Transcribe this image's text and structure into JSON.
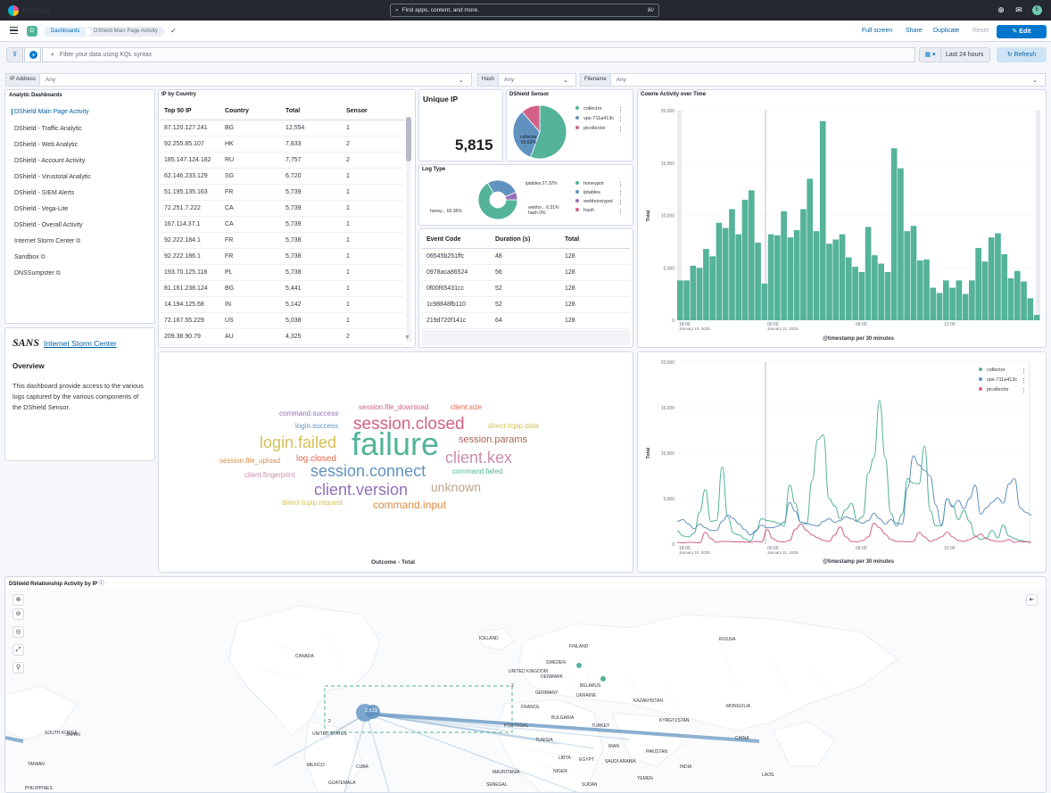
{
  "topbar": {
    "brand": "elastic",
    "search_placeholder": "Find apps, content, and more.",
    "search_shortcut": "⌘/",
    "avatar": "E"
  },
  "header": {
    "space_initial": "D",
    "breadcrumb_dashboards": "Dashboards",
    "breadcrumb_current": "DShield Main Page Activity",
    "full_screen": "Full screen",
    "share": "Share",
    "duplicate": "Duplicate",
    "reset": "Reset",
    "edit": "Edit"
  },
  "query": {
    "placeholder": "Filter your data using KQL syntax",
    "time_range": "Last 24 hours",
    "refresh": "Refresh"
  },
  "controls": [
    {
      "label": "IP Address",
      "value": "Any"
    },
    {
      "label": "Hash",
      "value": "Any"
    },
    {
      "label": "Filename",
      "value": "Any"
    }
  ],
  "nav": {
    "title": "Analytic Dashboards",
    "items": [
      "DShield Main Page Activity",
      "DShield - Traffic Analytic",
      "DShield - Web Analytic",
      "DShield - Account Activity",
      "DShield - Virustotal Analytic",
      "DShield - SIEM Alerts",
      "DShield - Vega-Lite",
      "DShield - Overall Activity",
      "Internet Storm Center",
      "Sandbox",
      "DNSSumpster"
    ]
  },
  "sans": {
    "logo": "SANS",
    "link": "Internet Storm Center",
    "heading": "Overview",
    "body": "This dashboard provide access to the various logs captured by the various components of the DShield Sensor."
  },
  "ip_country": {
    "title": "IP by Country",
    "columns": [
      "Top 50 IP",
      "Country",
      "Total",
      "Sensor"
    ],
    "rows": [
      [
        "87.120.127.241",
        "BG",
        "12,554",
        "1"
      ],
      [
        "92.255.85.107",
        "HK",
        "7,833",
        "2"
      ],
      [
        "185.147.124.182",
        "RU",
        "7,757",
        "2"
      ],
      [
        "62.146.233.129",
        "SG",
        "6,720",
        "1"
      ],
      [
        "51.195.135.163",
        "FR",
        "5,739",
        "1"
      ],
      [
        "72.251.7.222",
        "CA",
        "5,739",
        "1"
      ],
      [
        "167.114.37.1",
        "CA",
        "5,739",
        "1"
      ],
      [
        "92.222.184.1",
        "FR",
        "5,738",
        "1"
      ],
      [
        "92.222.186.1",
        "FR",
        "5,738",
        "1"
      ],
      [
        "193.70.125.118",
        "PL",
        "5,738",
        "1"
      ],
      [
        "81.161.238.124",
        "BG",
        "5,441",
        "1"
      ],
      [
        "14.194.125.58",
        "IN",
        "5,142",
        "1"
      ],
      [
        "72.167.55.229",
        "US",
        "5,038",
        "1"
      ],
      [
        "209.38.90.79",
        "AU",
        "4,325",
        "2"
      ]
    ]
  },
  "unique_ip": {
    "title": "Unique IP",
    "value": "5,815"
  },
  "sensor_pie": {
    "title": "DShield Sensor",
    "legend": [
      {
        "name": "collector",
        "color": "#54b399"
      },
      {
        "name": "vps-711a413c",
        "color": "#6092c0"
      },
      {
        "name": "picollector",
        "color": "#d36086"
      }
    ],
    "slice_label": "collector",
    "slice_pct": "55.63%"
  },
  "log_type": {
    "title": "Log Type",
    "legend": [
      {
        "name": "honeypot",
        "color": "#54b399"
      },
      {
        "name": "iptables",
        "color": "#6092c0"
      },
      {
        "name": "webhoneypot",
        "color": "#9170b8"
      },
      {
        "name": "hash",
        "color": "#d36086"
      }
    ],
    "label_iptables": "iptables  27.32%",
    "label_honey": "honey...  66.36%",
    "label_webho": "webho...  6.31%",
    "label_hash": "hash  0%"
  },
  "events": {
    "columns": [
      "Event Code",
      "Duration (s)",
      "Total"
    ],
    "rows": [
      [
        "06545b251ffc",
        "48",
        "128"
      ],
      [
        "0978aca86524",
        "56",
        "128"
      ],
      [
        "0f00f65431cc",
        "52",
        "128"
      ],
      [
        "1c98848fb110",
        "52",
        "128"
      ],
      [
        "219d720f141c",
        "64",
        "128"
      ]
    ]
  },
  "cowrie": {
    "title": "Cowrie Activity over Time",
    "ylabel": "Total",
    "xlabel": "@timestamp per 30 minutes",
    "y_ticks": [
      "20,000",
      "15,000",
      "10,000",
      "5,000",
      "0"
    ],
    "x_ticks": [
      {
        "time": "18:00",
        "date": "January 10, 2025"
      },
      {
        "time": "00:00",
        "date": "January 11, 2025"
      },
      {
        "time": "06:00",
        "date": ""
      },
      {
        "time": "12:00",
        "date": ""
      }
    ]
  },
  "chart_data": [
    {
      "type": "bar",
      "title": "Cowrie Activity over Time",
      "xlabel": "@timestamp per 30 minutes",
      "ylabel": "Total",
      "ylim": [
        0,
        20000
      ],
      "color": "#54b399",
      "values": [
        3800,
        3800,
        5200,
        5000,
        6800,
        6100,
        9300,
        8800,
        10600,
        8200,
        11500,
        12400,
        7400,
        3500,
        8200,
        8100,
        10400,
        7900,
        8600,
        10600,
        13500,
        8500,
        19000,
        7300,
        7700,
        8200,
        6000,
        5100,
        4600,
        8900,
        6200,
        5400,
        4600,
        16400,
        14500,
        8500,
        9000,
        5700,
        5800,
        3100,
        2600,
        3800,
        3100,
        3800,
        2500,
        3800,
        6900,
        5600,
        7900,
        8300,
        6300,
        4000,
        4700,
        3700,
        2100,
        500
      ]
    },
    {
      "type": "line",
      "xlabel": "@timestamp per 30 minutes",
      "ylabel": "Total",
      "ylim": [
        0,
        20000
      ],
      "series": [
        {
          "name": "collector",
          "color": "#54b399",
          "values": [
            1500,
            900,
            800,
            1200,
            3500,
            6000,
            2500,
            2600,
            8500,
            3000,
            1200,
            1000,
            600,
            300,
            1400,
            2800,
            2600,
            2500,
            2300,
            2000,
            6500,
            4500,
            2400,
            2200,
            7000,
            11500,
            12000,
            5000,
            4200,
            2800,
            3800,
            4500,
            2600,
            3000,
            7800,
            9500,
            15800,
            9500,
            3400,
            2000,
            3300,
            7200,
            6700,
            6600,
            10800,
            3700,
            2000,
            2000,
            5000,
            4200,
            2700,
            3700,
            2500,
            900,
            500,
            700,
            1500,
            700,
            2100,
            900,
            600,
            400,
            300,
            200
          ]
        },
        {
          "name": "vps-711a413c",
          "color": "#6092c0",
          "values": [
            2500,
            2700,
            2200,
            1700,
            2200,
            1800,
            1500,
            1500,
            2500,
            3200,
            2800,
            2200,
            1600,
            1000,
            1500,
            2100,
            1800,
            1800,
            2000,
            2400,
            4600,
            3600,
            2400,
            2300,
            2100,
            2000,
            2500,
            2800,
            2400,
            2600,
            3000,
            2800,
            2500,
            2300,
            2600,
            3400,
            2800,
            2200,
            2700,
            2300,
            2200,
            6200,
            9700,
            8700,
            8100,
            7500,
            4300,
            2100,
            5000,
            4100,
            4800,
            3900,
            5000,
            6500,
            3300,
            4000,
            4600,
            5100,
            4500,
            6600,
            7200,
            4000,
            3500,
            3200
          ]
        },
        {
          "name": "picollector",
          "color": "#d36086",
          "values": [
            200,
            150,
            200,
            200,
            150,
            1300,
            600,
            200,
            300,
            300,
            250,
            250,
            250,
            200,
            300,
            250,
            1600,
            600,
            300,
            250,
            400,
            1600,
            2200,
            1500,
            1000,
            700,
            400,
            300,
            1000,
            1900,
            800,
            300,
            250,
            400,
            800,
            2300,
            1800,
            1100,
            500,
            300,
            300,
            250,
            300,
            1300,
            800,
            300,
            500,
            800,
            1300,
            800,
            400,
            300,
            500,
            800,
            1100,
            600,
            400,
            300,
            300,
            500,
            200,
            300,
            250,
            200
          ]
        }
      ]
    },
    {
      "type": "pie",
      "title": "DShield Sensor",
      "categories": [
        "collector",
        "vps-711a413c",
        "picollector"
      ],
      "values": [
        55.63,
        33.0,
        11.37
      ]
    },
    {
      "type": "pie",
      "title": "Log Type",
      "categories": [
        "honeypot",
        "iptables",
        "webhoneypot",
        "hash"
      ],
      "values": [
        66.36,
        27.32,
        6.31,
        0
      ]
    }
  ],
  "wordcloud": {
    "title": "Outcome - Total",
    "words": [
      {
        "text": "failure",
        "color": "#54b399"
      },
      {
        "text": "session.closed",
        "color": "#d36086"
      },
      {
        "text": "login.failed",
        "color": "#d6bf57"
      },
      {
        "text": "client.kex",
        "color": "#ca8eae"
      },
      {
        "text": "session.connect",
        "color": "#6092c0"
      },
      {
        "text": "client.version",
        "color": "#9170b8"
      },
      {
        "text": "unknown",
        "color": "#b9a888"
      },
      {
        "text": "session.params",
        "color": "#aa6556"
      },
      {
        "text": "command.input",
        "color": "#da8b45"
      },
      {
        "text": "log.closed",
        "color": "#e7664c"
      },
      {
        "text": "session.file_download",
        "color": "#d36086"
      },
      {
        "text": "client.size",
        "color": "#e7664c"
      },
      {
        "text": "command.success",
        "color": "#9170b8"
      },
      {
        "text": "login.success",
        "color": "#6092c0"
      },
      {
        "text": "direct-tcpip.data",
        "color": "#d6bf57"
      },
      {
        "text": "session.file_upload",
        "color": "#da8b45"
      },
      {
        "text": "command.failed",
        "color": "#54b399"
      },
      {
        "text": "client.fingerprint",
        "color": "#ca8eae"
      },
      {
        "text": "direct-tcpip.request",
        "color": "#d6bf57"
      }
    ]
  },
  "map": {
    "title": "DShield Relationship Activity by IP",
    "cluster_label": "2,613",
    "box_label_1": "2",
    "box_label_2": "2",
    "countries": [
      "ICELAND",
      "FINLAND",
      "RUSSIA",
      "SWEDEN",
      "CANADA",
      "UNITED KINGDOM",
      "DENMARK",
      "BELARUS",
      "GERMANY",
      "UKRAINE",
      "FRANCE",
      "KAZAKHSTAN",
      "MONGOLIA",
      "BULGARIA",
      "KYRGYZSTAN",
      "PORTUGAL",
      "TURKEY",
      "UNITED STATES",
      "TUNISIA",
      "SOUTH KOREA",
      "JAPAN",
      "IRAN",
      "CHINA",
      "MEXICO",
      "CUBA",
      "LIBYA",
      "EGYPT",
      "SAUDI ARABIA",
      "PAKISTAN",
      "INDIA",
      "MAURITANIA",
      "NIGER",
      "SUDAN",
      "GUATEMALA",
      "SENEGAL",
      "YEMEN",
      "LAOS",
      "TAIWAN",
      "PHILIPPINES"
    ]
  }
}
